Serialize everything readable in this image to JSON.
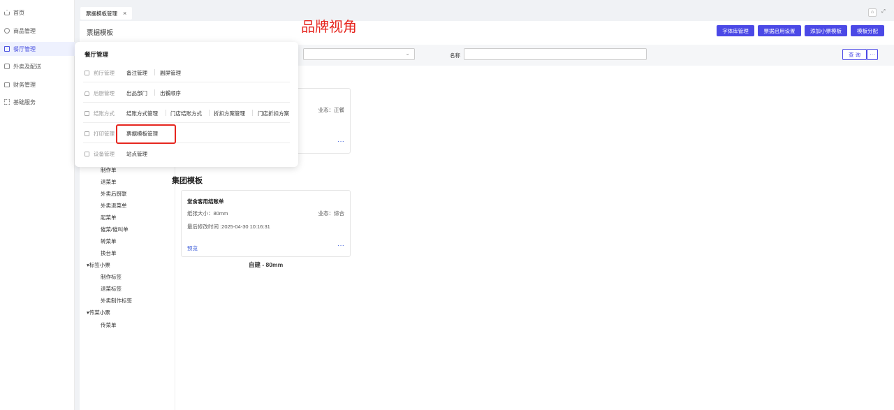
{
  "sidebar": {
    "items": [
      {
        "label": "首页",
        "icon": "home-icon"
      },
      {
        "label": "商品管理",
        "icon": "cube-icon"
      },
      {
        "label": "餐厅管理",
        "icon": "store-icon",
        "active": true
      },
      {
        "label": "外卖及配送",
        "icon": "delivery-icon"
      },
      {
        "label": "财务管理",
        "icon": "folder-icon"
      },
      {
        "label": "基础服务",
        "icon": "grid-icon"
      }
    ],
    "accent_color": "#4b52e0"
  },
  "tabbar": {
    "tab_label": "票据模板管理",
    "close": "×"
  },
  "header": {
    "page_title": "票据模板",
    "brand_caption": "品牌视角",
    "buttons": [
      "字体库管理",
      "票据启用设置",
      "添加小票模板",
      "模板分配"
    ],
    "button_color": "#4b49e6"
  },
  "filter": {
    "name_label": "名称",
    "query_label": "查 询",
    "more_label": "···"
  },
  "dropdown": {
    "title": "餐厅管理",
    "rows": [
      {
        "category": "前厅管理",
        "links": [
          "备注管理",
          "副屏管理"
        ]
      },
      {
        "category": "后厨管理",
        "links": [
          "出品部门",
          "出餐顺序"
        ]
      },
      {
        "category": "结账方式",
        "links": [
          "结账方式管理",
          "门店结账方式",
          "折扣方案管理",
          "门店折扣方案"
        ]
      },
      {
        "category": "打印管理",
        "links": [
          "票据模板管理"
        ]
      },
      {
        "category": "设备管理",
        "links": [
          "站点管理"
        ]
      }
    ]
  },
  "tree": {
    "items": [
      {
        "label": "制作单",
        "level": 2
      },
      {
        "label": "退菜单",
        "level": 2
      },
      {
        "label": "外卖后厨联",
        "level": 2
      },
      {
        "label": "外卖退菜单",
        "level": 2
      },
      {
        "label": "起菜单",
        "level": 2
      },
      {
        "label": "催菜/催叫单",
        "level": 2
      },
      {
        "label": "转菜单",
        "level": 2
      },
      {
        "label": "换台单",
        "level": 2
      },
      {
        "label": "▾标签小票",
        "level": 1
      },
      {
        "label": "制作标签",
        "level": 2
      },
      {
        "label": "退菜标签",
        "level": 2
      },
      {
        "label": "外卖制作标签",
        "level": 2
      },
      {
        "label": "▾传菜小票",
        "level": 1
      },
      {
        "label": "传菜单",
        "level": 2
      }
    ]
  },
  "top_card": {
    "biz": "业态：正餐",
    "dots": "···"
  },
  "group_section": {
    "heading": "集团模板",
    "card": {
      "title": "堂食客用结账单",
      "size": "纸张大小：80mm",
      "biz": "业态：综合",
      "time": "最后修改时间 :2025-04-30 10:16:31",
      "preview": "预览",
      "dots": "···"
    },
    "caption": "自建 - 80mm"
  }
}
